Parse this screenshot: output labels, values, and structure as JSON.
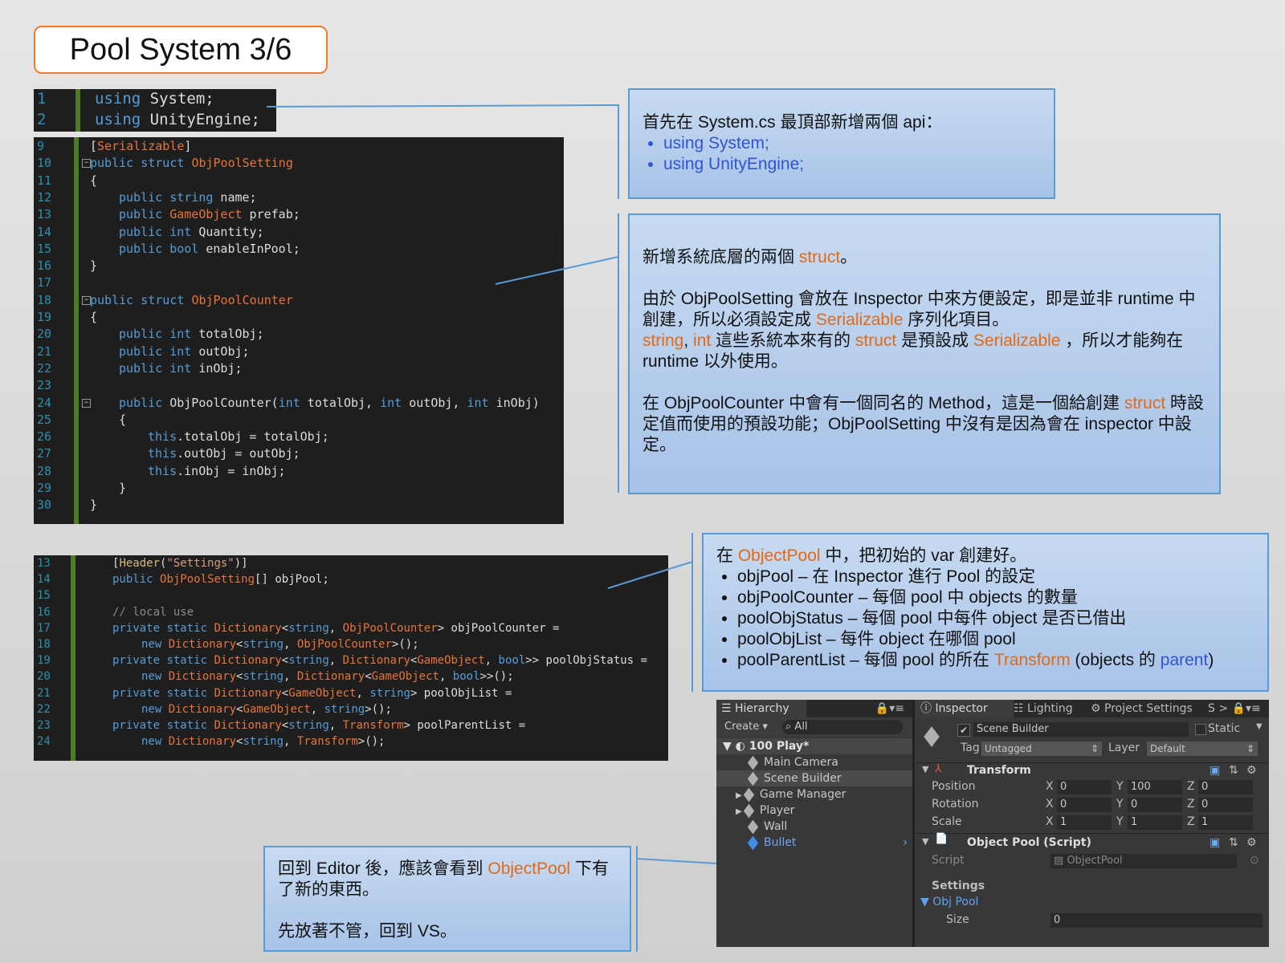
{
  "title": "Pool System 3/6",
  "code1": [
    {
      "ln": "1",
      "parts": [
        [
          "kw",
          "using"
        ],
        [
          "",
          "System;"
        ]
      ]
    },
    {
      "ln": "2",
      "parts": [
        [
          "kw",
          "using"
        ],
        [
          "",
          "UnityEngine;"
        ]
      ]
    }
  ],
  "code2": [
    {
      "ln": "9",
      "indent": 0,
      "parts": [
        [
          "",
          "["
        ],
        [
          "ty",
          "Serializable"
        ],
        [
          "",
          "]"
        ]
      ]
    },
    {
      "ln": "10",
      "indent": 0,
      "fold": true,
      "parts": [
        [
          "kw",
          "public"
        ],
        [
          "",
          " "
        ],
        [
          "kw",
          "struct"
        ],
        [
          "",
          " "
        ],
        [
          "ty",
          "ObjPoolSetting"
        ]
      ]
    },
    {
      "ln": "11",
      "indent": 0,
      "parts": [
        [
          "",
          "{"
        ]
      ]
    },
    {
      "ln": "12",
      "indent": 1,
      "parts": [
        [
          "kw",
          "public"
        ],
        [
          "",
          " "
        ],
        [
          "kw",
          "string"
        ],
        [
          "",
          " name;"
        ]
      ]
    },
    {
      "ln": "13",
      "indent": 1,
      "parts": [
        [
          "kw",
          "public"
        ],
        [
          "",
          " "
        ],
        [
          "ty",
          "GameObject"
        ],
        [
          "",
          " prefab;"
        ]
      ]
    },
    {
      "ln": "14",
      "indent": 1,
      "parts": [
        [
          "kw",
          "public"
        ],
        [
          "",
          " "
        ],
        [
          "kw",
          "int"
        ],
        [
          "",
          " Quantity;"
        ]
      ]
    },
    {
      "ln": "15",
      "indent": 1,
      "parts": [
        [
          "kw",
          "public"
        ],
        [
          "",
          " "
        ],
        [
          "kw",
          "bool"
        ],
        [
          "",
          " enableInPool;"
        ]
      ]
    },
    {
      "ln": "16",
      "indent": 0,
      "parts": [
        [
          "",
          "}"
        ]
      ]
    },
    {
      "ln": "17",
      "indent": 0,
      "parts": []
    },
    {
      "ln": "18",
      "indent": 0,
      "fold": true,
      "parts": [
        [
          "kw",
          "public"
        ],
        [
          "",
          " "
        ],
        [
          "kw",
          "struct"
        ],
        [
          "",
          " "
        ],
        [
          "ty",
          "ObjPoolCounter"
        ]
      ]
    },
    {
      "ln": "19",
      "indent": 0,
      "parts": [
        [
          "",
          "{"
        ]
      ]
    },
    {
      "ln": "20",
      "indent": 1,
      "parts": [
        [
          "kw",
          "public"
        ],
        [
          "",
          " "
        ],
        [
          "kw",
          "int"
        ],
        [
          "",
          " totalObj;"
        ]
      ]
    },
    {
      "ln": "21",
      "indent": 1,
      "parts": [
        [
          "kw",
          "public"
        ],
        [
          "",
          " "
        ],
        [
          "kw",
          "int"
        ],
        [
          "",
          " outObj;"
        ]
      ]
    },
    {
      "ln": "22",
      "indent": 1,
      "parts": [
        [
          "kw",
          "public"
        ],
        [
          "",
          " "
        ],
        [
          "kw",
          "int"
        ],
        [
          "",
          " inObj;"
        ]
      ]
    },
    {
      "ln": "23",
      "indent": 0,
      "parts": []
    },
    {
      "ln": "24",
      "indent": 1,
      "fold": true,
      "parts": [
        [
          "kw",
          "public"
        ],
        [
          "",
          " ObjPoolCounter("
        ],
        [
          "kw",
          "int"
        ],
        [
          "",
          " totalObj, "
        ],
        [
          "kw",
          "int"
        ],
        [
          "",
          " outObj, "
        ],
        [
          "kw",
          "int"
        ],
        [
          "",
          " inObj)"
        ]
      ]
    },
    {
      "ln": "25",
      "indent": 1,
      "parts": [
        [
          "",
          "{"
        ]
      ]
    },
    {
      "ln": "26",
      "indent": 2,
      "parts": [
        [
          "kw",
          "this"
        ],
        [
          "",
          ".totalObj = totalObj;"
        ]
      ]
    },
    {
      "ln": "27",
      "indent": 2,
      "parts": [
        [
          "kw",
          "this"
        ],
        [
          "",
          ".outObj = outObj;"
        ]
      ]
    },
    {
      "ln": "28",
      "indent": 2,
      "parts": [
        [
          "kw",
          "this"
        ],
        [
          "",
          ".inObj = inObj;"
        ]
      ]
    },
    {
      "ln": "29",
      "indent": 1,
      "parts": [
        [
          "",
          "}"
        ]
      ]
    },
    {
      "ln": "30",
      "indent": 0,
      "parts": [
        [
          "",
          "}"
        ]
      ]
    }
  ],
  "code3": [
    {
      "ln": "13",
      "indent": 1,
      "parts": [
        [
          "",
          "["
        ],
        [
          "hd",
          "Header"
        ],
        [
          "",
          "("
        ],
        [
          "st",
          "\"Settings\""
        ],
        [
          "",
          ")]"
        ]
      ]
    },
    {
      "ln": "14",
      "indent": 1,
      "parts": [
        [
          "kw",
          "public"
        ],
        [
          "",
          " "
        ],
        [
          "ty",
          "ObjPoolSetting"
        ],
        [
          "",
          "[] objPool;"
        ]
      ]
    },
    {
      "ln": "15",
      "indent": 1,
      "parts": []
    },
    {
      "ln": "16",
      "indent": 1,
      "parts": [
        [
          "cm",
          "// local use"
        ]
      ]
    },
    {
      "ln": "17",
      "indent": 1,
      "parts": [
        [
          "kw",
          "private"
        ],
        [
          "",
          " "
        ],
        [
          "kw",
          "static"
        ],
        [
          "",
          " "
        ],
        [
          "ty",
          "Dictionary"
        ],
        [
          "",
          "<"
        ],
        [
          "kw",
          "string"
        ],
        [
          "",
          ", "
        ],
        [
          "ty",
          "ObjPoolCounter"
        ],
        [
          "",
          "> objPoolCounter ="
        ]
      ]
    },
    {
      "ln": "18",
      "indent": 2,
      "parts": [
        [
          "kw",
          "new"
        ],
        [
          "",
          " "
        ],
        [
          "ty",
          "Dictionary"
        ],
        [
          "",
          "<"
        ],
        [
          "kw",
          "string"
        ],
        [
          "",
          ", "
        ],
        [
          "ty",
          "ObjPoolCounter"
        ],
        [
          "",
          ">();"
        ]
      ]
    },
    {
      "ln": "19",
      "indent": 1,
      "parts": [
        [
          "kw",
          "private"
        ],
        [
          "",
          " "
        ],
        [
          "kw",
          "static"
        ],
        [
          "",
          " "
        ],
        [
          "ty",
          "Dictionary"
        ],
        [
          "",
          "<"
        ],
        [
          "kw",
          "string"
        ],
        [
          "",
          ", "
        ],
        [
          "ty",
          "Dictionary"
        ],
        [
          "",
          "<"
        ],
        [
          "ty",
          "GameObject"
        ],
        [
          "",
          ", "
        ],
        [
          "kw",
          "bool"
        ],
        [
          "",
          ">> poolObjStatus ="
        ]
      ]
    },
    {
      "ln": "20",
      "indent": 2,
      "parts": [
        [
          "kw",
          "new"
        ],
        [
          "",
          " "
        ],
        [
          "ty",
          "Dictionary"
        ],
        [
          "",
          "<"
        ],
        [
          "kw",
          "string"
        ],
        [
          "",
          ", "
        ],
        [
          "ty",
          "Dictionary"
        ],
        [
          "",
          "<"
        ],
        [
          "ty",
          "GameObject"
        ],
        [
          "",
          ", "
        ],
        [
          "kw",
          "bool"
        ],
        [
          "",
          ">>();"
        ]
      ]
    },
    {
      "ln": "21",
      "indent": 1,
      "parts": [
        [
          "kw",
          "private"
        ],
        [
          "",
          " "
        ],
        [
          "kw",
          "static"
        ],
        [
          "",
          " "
        ],
        [
          "ty",
          "Dictionary"
        ],
        [
          "",
          "<"
        ],
        [
          "ty",
          "GameObject"
        ],
        [
          "",
          ", "
        ],
        [
          "kw",
          "string"
        ],
        [
          "",
          "> poolObjList ="
        ]
      ]
    },
    {
      "ln": "22",
      "indent": 2,
      "parts": [
        [
          "kw",
          "new"
        ],
        [
          "",
          " "
        ],
        [
          "ty",
          "Dictionary"
        ],
        [
          "",
          "<"
        ],
        [
          "ty",
          "GameObject"
        ],
        [
          "",
          ", "
        ],
        [
          "kw",
          "string"
        ],
        [
          "",
          ">();"
        ]
      ]
    },
    {
      "ln": "23",
      "indent": 1,
      "parts": [
        [
          "kw",
          "private"
        ],
        [
          "",
          " "
        ],
        [
          "kw",
          "static"
        ],
        [
          "",
          " "
        ],
        [
          "ty",
          "Dictionary"
        ],
        [
          "",
          "<"
        ],
        [
          "kw",
          "string"
        ],
        [
          "",
          ", "
        ],
        [
          "ty",
          "Transform"
        ],
        [
          "",
          "> poolParentList ="
        ]
      ]
    },
    {
      "ln": "24",
      "indent": 2,
      "parts": [
        [
          "kw",
          "new"
        ],
        [
          "",
          " "
        ],
        [
          "ty",
          "Dictionary"
        ],
        [
          "",
          "<"
        ],
        [
          "kw",
          "string"
        ],
        [
          "",
          ", "
        ],
        [
          "ty",
          "Transform"
        ],
        [
          "",
          ">();"
        ]
      ]
    }
  ],
  "note1": {
    "intro": "首先在 System.cs 最頂部新增兩個 api：",
    "bullets": [
      "using System;",
      "using UnityEngine;"
    ]
  },
  "note2": {
    "p1a": "新增系統底層的兩個 ",
    "p1b": "struct",
    "p1c": "。",
    "p2a": "由於 ObjPoolSetting 會放在 Inspector 中來方便設定，即是並非 runtime 中創建，所以必須設定成 ",
    "p2b": "Serializable",
    "p2c": " 序列化項目。",
    "p3a": "string",
    "p3b": ", ",
    "p3c": "int",
    "p3d": " 這些系統本來有的 ",
    "p3e": "struct",
    "p3f": " 是預設成 ",
    "p3g": "Serializable",
    "p3h": " ，所以才能夠在 runtime 以外使用。",
    "p4a": "在 ObjPoolCounter 中會有一個同名的 Method，這是一個給創建 ",
    "p4b": "struct",
    "p4c": " 時設定值而使用的預設功能；ObjPoolSetting 中沒有是因為會在 inspector 中設定。"
  },
  "note3": {
    "intro_a": "在 ",
    "intro_b": "ObjectPool",
    "intro_c": " 中，把初始的 var 創建好。",
    "b1": "objPool – 在 Inspector 進行 Pool 的設定",
    "b2": "objPoolCounter – 每個 pool 中 objects 的數量",
    "b3": "poolObjStatus – 每個 pool 中每件 object 是否已借出",
    "b4": "poolObjList – 每件 object 在哪個 pool",
    "b5a": "poolParentList – 每個 pool 的所在 ",
    "b5b": "Transform",
    "b5c": " (objects 的 ",
    "b5d": "parent",
    "b5e": ")"
  },
  "note4": {
    "p1a": "回到 Editor 後，應該會看到 ",
    "p1b": "ObjectPool",
    "p1c": " 下有了新的東西。",
    "p2": "先放著不管，回到 VS。"
  },
  "unity": {
    "hier_tab": "Hierarchy",
    "create": "Create ▾",
    "search": "All",
    "scene": "100 Play*",
    "items": [
      "Main Camera",
      "Scene Builder",
      "Game Manager",
      "Player",
      "Wall",
      "Bullet"
    ],
    "tabs": [
      "Inspector",
      "Lighting",
      "Project Settings",
      "S >"
    ],
    "obj_name": "Scene Builder",
    "static": "Static",
    "tag_label": "Tag",
    "tag_value": "Untagged",
    "layer_label": "Layer",
    "layer_value": "Default",
    "transform": "Transform",
    "position": "Position",
    "rotation": "Rotation",
    "scale": "Scale",
    "pos": [
      "0",
      "100",
      "0"
    ],
    "rot": [
      "0",
      "0",
      "0"
    ],
    "scl": [
      "1",
      "1",
      "1"
    ],
    "axis": [
      "X",
      "Y",
      "Z"
    ],
    "script_comp": "Object Pool (Script)",
    "script_label": "Script",
    "script_value": "ObjectPool",
    "settings": "Settings",
    "objpool": "Obj Pool",
    "size_label": "Size",
    "size_value": "0"
  },
  "colors": {
    "accent_orange": "#ed7d31",
    "note_border": "#5b9bd5",
    "code_bg": "#1e1e1e"
  }
}
